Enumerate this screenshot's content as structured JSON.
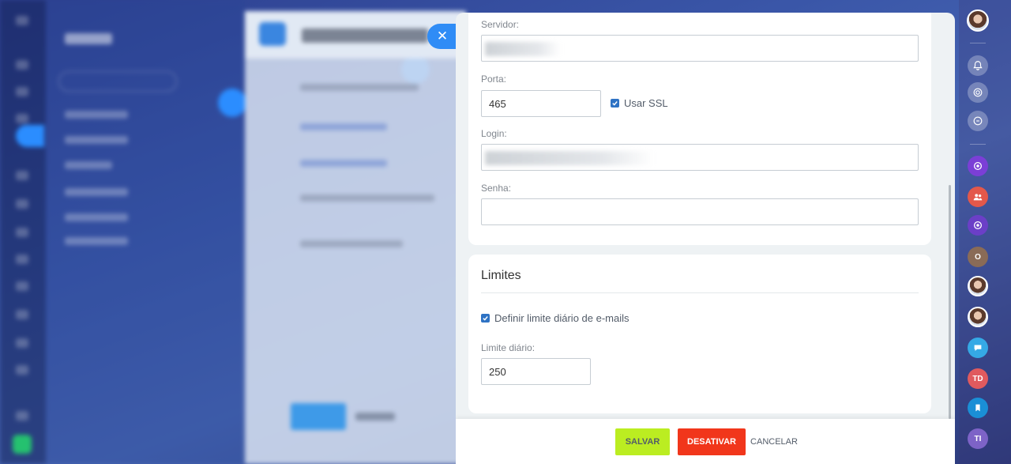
{
  "server": {
    "server_label": "Servidor:",
    "port_label": "Porta:",
    "port_value": "465",
    "ssl_label": "Usar SSL",
    "login_label": "Login:",
    "password_label": "Senha:"
  },
  "limits": {
    "title": "Limites",
    "daily_limit_checkbox": "Definir limite diário de e-mails",
    "daily_limit_label": "Limite diário:",
    "daily_limit_value": "250"
  },
  "footer": {
    "save": "SALVAR",
    "deactivate": "DESATIVAR",
    "cancel": "CANCELAR"
  },
  "rightbar": {
    "td_initials": "TD",
    "ti_initials": "TI",
    "o_initials": "O"
  },
  "colors": {
    "save": "#bbed21",
    "deactivate": "#f1361b",
    "checkbox": "#2f73c4",
    "close_tab": "#2f8cf6"
  }
}
